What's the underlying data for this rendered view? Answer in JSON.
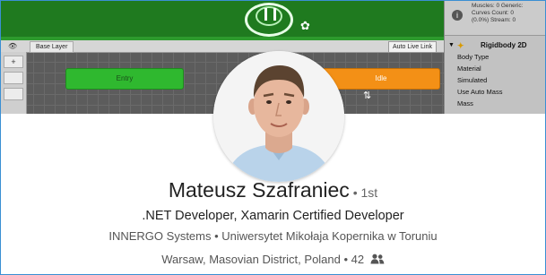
{
  "banner": {
    "scene": {
      "gear_glyph": "✿"
    },
    "animator": {
      "eye_glyph": "👁",
      "layer_tab": "Base Layer",
      "live_link": "Auto Live Link",
      "add_glyph": "+",
      "states": {
        "entry": "Entry",
        "idle": "Idle"
      },
      "transition_glyph": "⇅"
    },
    "inspector": {
      "info_glyph": "i",
      "info_lines": [
        "Muscles: 0 Generic:",
        "Curves Count: 0",
        "(0.0%) Stream: 0"
      ],
      "component_title": "Rigidbody 2D",
      "fold_glyph": "▼",
      "component_icon_glyph": "✦",
      "properties": [
        "Body Type",
        "Material",
        "Simulated",
        "Use Auto Mass",
        "Mass"
      ]
    }
  },
  "profile": {
    "name": "Mateusz Szafraniec",
    "degree": " • 1st",
    "headline": ".NET Developer, Xamarin Certified Developer",
    "companies": "INNERGO Systems • Uniwersytet Mikołaja Kopernika w Toruniu",
    "location": "Warsaw, Masovian District, Poland",
    "connections": " • 42",
    "connections_icon": "people-icon"
  },
  "colors": {
    "scene_green": "#1f7a1f",
    "entry_state": "#2fb82f",
    "idle_state": "#f39016",
    "frame_border": "#3a8fd3"
  }
}
